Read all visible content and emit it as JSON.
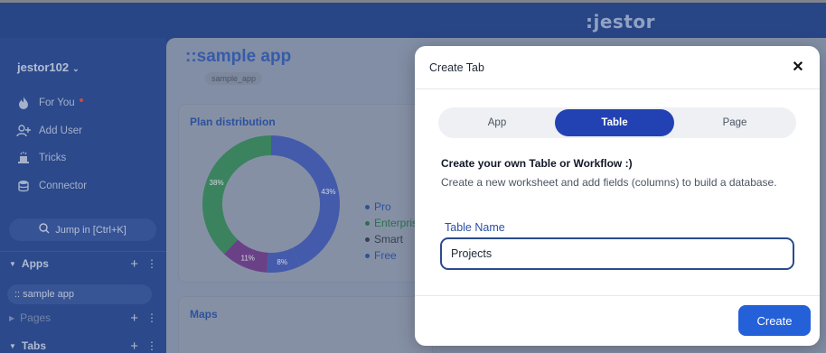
{
  "brand": {
    "logo": ":jestor"
  },
  "sidebar": {
    "user": "jestor102",
    "items": [
      {
        "label": "For You",
        "icon": "flame-icon"
      },
      {
        "label": "Add User",
        "icon": "add-user-icon"
      },
      {
        "label": "Tricks",
        "icon": "magic-hat-icon"
      },
      {
        "label": "Connector",
        "icon": "database-icon"
      }
    ],
    "jump": "Jump in [Ctrl+K]",
    "sections": {
      "apps": "Apps",
      "app_item": ":: sample app",
      "pages": "Pages",
      "tabs": "Tabs"
    }
  },
  "main": {
    "title": "::sample app",
    "chip": "sample_app",
    "plan_card": {
      "title": "Plan distribution",
      "slices": [
        {
          "label": "Pro",
          "value": 43,
          "text": "43%",
          "color": "#4a63b8"
        },
        {
          "label": "Enterprise",
          "value": 38,
          "text": "38%",
          "color": "#3f8f63"
        },
        {
          "label": "Smart",
          "value": 11,
          "text": "11%",
          "color": "#74468f"
        },
        {
          "label": "Free",
          "value": 8,
          "text": "8%",
          "color": "#4a63b8"
        }
      ]
    },
    "maps_card": {
      "title": "Maps"
    }
  },
  "modal": {
    "title": "Create Tab",
    "tabs": [
      "App",
      "Table",
      "Page"
    ],
    "active_tab": "Table",
    "heading": "Create your own Table or Workflow :)",
    "description": "Create a new worksheet and add fields (columns) to build a database.",
    "field_label": "Table Name",
    "field_value": "Projects",
    "create_label": "Create"
  }
}
